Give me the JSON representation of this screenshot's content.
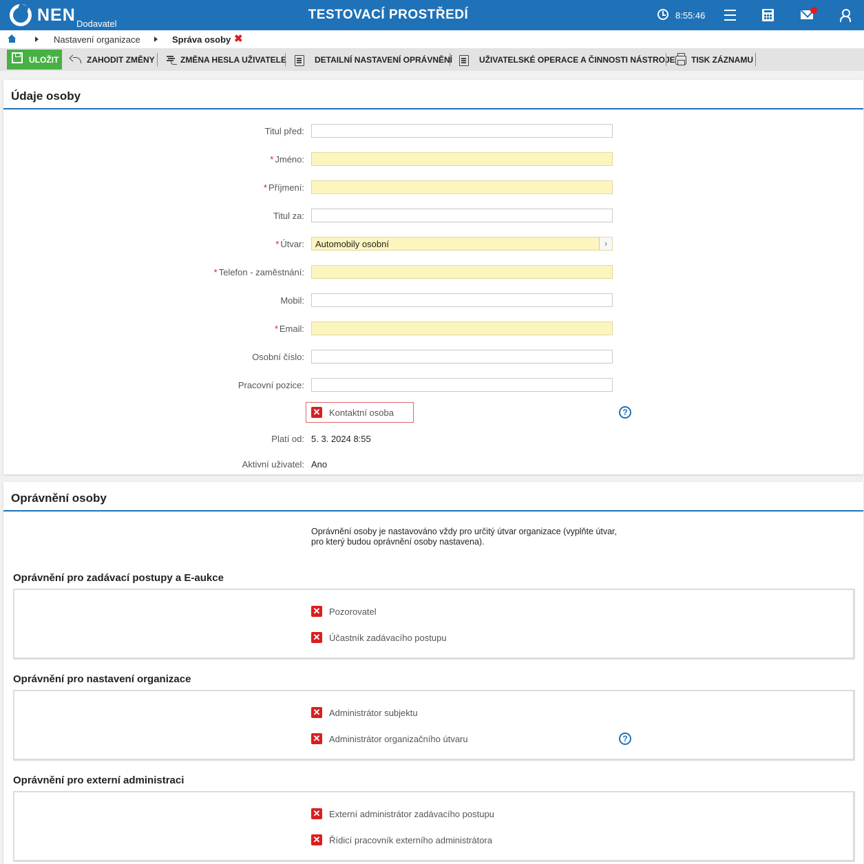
{
  "header": {
    "brand": "NEN",
    "brand_sub": "Dodavatel",
    "env_title": "TESTOVACÍ PROSTŘEDÍ",
    "time": "8:55:46",
    "icons": [
      "clock-icon",
      "menu-icon",
      "calculator-icon",
      "mail-icon",
      "user-icon"
    ]
  },
  "breadcrumb": {
    "items": [
      "Nastavení organizace",
      "Správa osoby"
    ],
    "close_symbol": "✖"
  },
  "toolbar": {
    "save_label": "ULOŽIT",
    "discard_label": "ZAHODIT ZMĚNY",
    "password_label": "ZMĚNA HESLA UŽIVATELE",
    "permissions_label": "DETAILNÍ NASTAVENÍ OPRÁVNĚNÍ",
    "operations_label": "UŽIVATELSKÉ OPERACE A ČINNOSTI NÁSTROJE",
    "print_label": "TISK ZÁZNAMU"
  },
  "person": {
    "title": "Údaje osoby",
    "fields": {
      "title_before": {
        "label": "Titul před:",
        "value": ""
      },
      "first_name": {
        "label": "Jméno:",
        "value": ""
      },
      "last_name": {
        "label": "Příjmení:",
        "value": ""
      },
      "title_after": {
        "label": "Titul za:",
        "value": ""
      },
      "department": {
        "label": "Útvar:",
        "value": "Automobily osobní"
      },
      "work_phone": {
        "label": "Telefon - zaměstnání:",
        "value": ""
      },
      "mobile": {
        "label": "Mobil:",
        "value": ""
      },
      "email": {
        "label": "Email:",
        "value": ""
      },
      "personal_number": {
        "label": "Osobní číslo:",
        "value": ""
      },
      "position": {
        "label": "Pracovní pozice:",
        "value": ""
      }
    },
    "required_marker": "*",
    "contact_person_label": "Kontaktní osoba",
    "valid_from": {
      "label": "Platí od:",
      "value": "5. 3. 2024 8:55"
    },
    "active_user": {
      "label": "Aktivní uživatel:",
      "value": "Ano"
    }
  },
  "permissions": {
    "title": "Oprávnění osoby",
    "info": "Oprávnění osoby je nastavováno vždy pro určitý útvar organizace (vyplňte útvar, pro který budou oprávnění osoby nastavena).",
    "groups": [
      {
        "title": "Oprávnění pro zadávací postupy a E-aukce",
        "items": [
          "Pozorovatel",
          "Účastník zadávacího postupu"
        ]
      },
      {
        "title": "Oprávnění pro nastavení organizace",
        "items": [
          "Administrátor subjektu",
          "Administrátor organizačního útvaru"
        ]
      },
      {
        "title": "Oprávnění pro externí administraci",
        "items": [
          "Externí administrátor zadávacího postupu",
          "Řídicí pracovník externího administrátora"
        ]
      }
    ]
  },
  "symbols": {
    "unchecked": "✕",
    "help": "?",
    "lookup": "›"
  },
  "colors": {
    "header": "#1f72b8",
    "save": "#47b144",
    "required_bg": "#fdf5be",
    "unchecked": "#d9201e"
  }
}
